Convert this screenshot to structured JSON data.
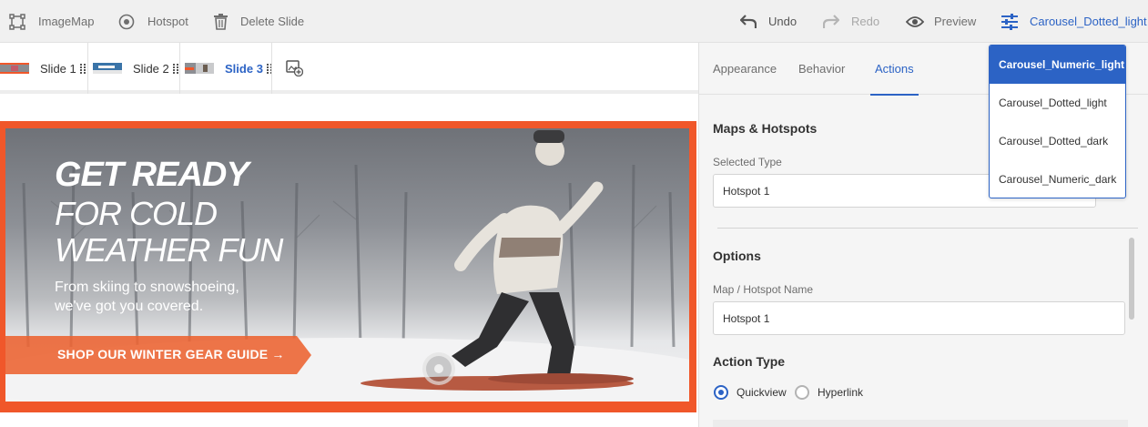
{
  "toolbar": {
    "imagemap": "ImageMap",
    "hotspot": "Hotspot",
    "delete_slide": "Delete Slide",
    "undo": "Undo",
    "redo": "Redo",
    "preview": "Preview",
    "preset": "Carousel_Dotted_light",
    "icons": [
      "imagemap-icon",
      "hotspot-icon",
      "trash-icon",
      "undo-icon",
      "redo-icon",
      "eye-icon",
      "sliders-icon"
    ]
  },
  "slides": [
    {
      "label": "Slide",
      "number": "1",
      "active": false
    },
    {
      "label": "Slide",
      "number": "2",
      "active": false
    },
    {
      "label": "Slide",
      "number": "3",
      "active": true
    }
  ],
  "banner": {
    "headline1": "GET READY",
    "headline2": "FOR COLD WEATHER FUN",
    "subtext": "From skiing to snowshoeing, we've got you covered.",
    "cta": "SHOP OUR WINTER GEAR GUIDE →"
  },
  "panel": {
    "tabs": [
      "Appearance",
      "Behavior",
      "Actions"
    ],
    "active_tab": "Actions",
    "maps_hotspots_title": "Maps & Hotspots",
    "selected_type_label": "Selected Type",
    "selected_type_value": "Hotspot 1",
    "options_title": "Options",
    "name_label": "Map / Hotspot Name",
    "name_value": "Hotspot 1",
    "action_type_title": "Action Type",
    "action_types": [
      "Quickview",
      "Hyperlink"
    ],
    "action_type_selected": "Quickview"
  },
  "preset_dropdown": {
    "options": [
      "Carousel_Numeric_light",
      "Carousel_Dotted_light",
      "Carousel_Dotted_dark",
      "Carousel_Numeric_dark"
    ],
    "highlighted": "Carousel_Numeric_light"
  },
  "colors": {
    "accent": "#2c63c5",
    "banner_frame": "#f0572a"
  }
}
